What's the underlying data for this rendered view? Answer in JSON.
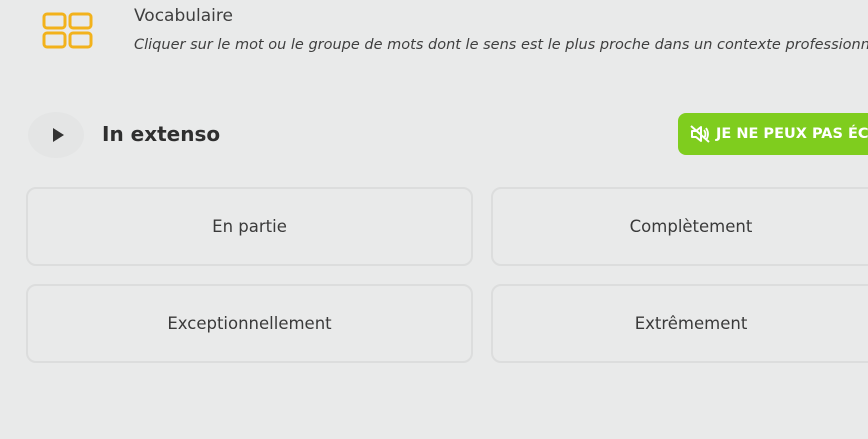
{
  "header": {
    "icon": "grid-cards-icon",
    "title": "Vocabulaire",
    "instruction": "Cliquer sur le mot ou le groupe de mots dont le sens est le plus proche dans un contexte professionnel."
  },
  "question": {
    "play_icon": "play-icon",
    "word": "In extenso",
    "cant_listen_label": "JE NE PEUX PAS ÉCO",
    "cant_listen_icon": "speaker-muted-icon",
    "accent_color": "#7fcd1e"
  },
  "options": [
    {
      "label": "En partie"
    },
    {
      "label": "Complètement"
    },
    {
      "label": "Exceptionnellement"
    },
    {
      "label": "Extrêmement"
    }
  ]
}
